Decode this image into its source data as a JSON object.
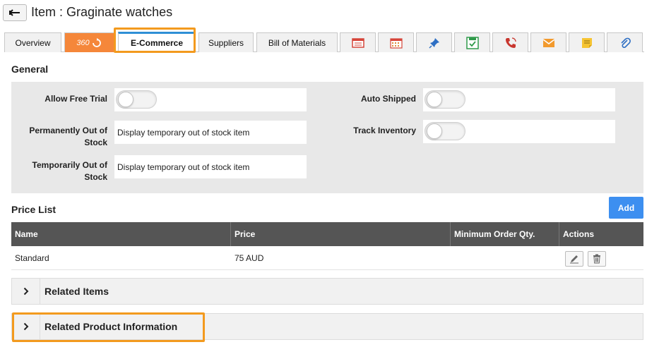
{
  "header": {
    "title": "Item : Graginate watches",
    "back_icon": "back-arrow-icon"
  },
  "tabs": {
    "overview": "Overview",
    "three_sixty": "360",
    "ecommerce": "E-Commerce",
    "suppliers": "Suppliers",
    "bom": "Bill of Materials",
    "icons": [
      "invoice-icon",
      "calendar-icon",
      "pin-icon",
      "save-icon",
      "phone-icon",
      "email-icon",
      "note-icon",
      "attachment-icon"
    ],
    "colors": {
      "orange_tab": "#f5873a",
      "active_border": "#2f8fd6",
      "highlight": "#f39a1e"
    }
  },
  "general": {
    "title": "General",
    "allow_free_trial_label": "Allow Free Trial",
    "allow_free_trial_on": false,
    "permanently_label_line1": "Permanently Out of",
    "permanently_label_line2": "Stock",
    "permanently_value": "Display temporary out of stock item",
    "temporarily_label_line1": "Temporarily Out of",
    "temporarily_label_line2": "Stock",
    "temporarily_value": "Display temporary out of stock item",
    "auto_shipped_label": "Auto Shipped",
    "auto_shipped_on": false,
    "track_inventory_label": "Track Inventory",
    "track_inventory_on": false
  },
  "price_list": {
    "title": "Price List",
    "add_label": "Add",
    "columns": [
      "Name",
      "Price",
      "Minimum Order Qty.",
      "Actions"
    ],
    "rows": [
      {
        "name": "Standard",
        "price": "75 AUD",
        "min_qty": ""
      }
    ]
  },
  "accordions": {
    "related_items": "Related Items",
    "related_product_info": "Related Product Information"
  }
}
